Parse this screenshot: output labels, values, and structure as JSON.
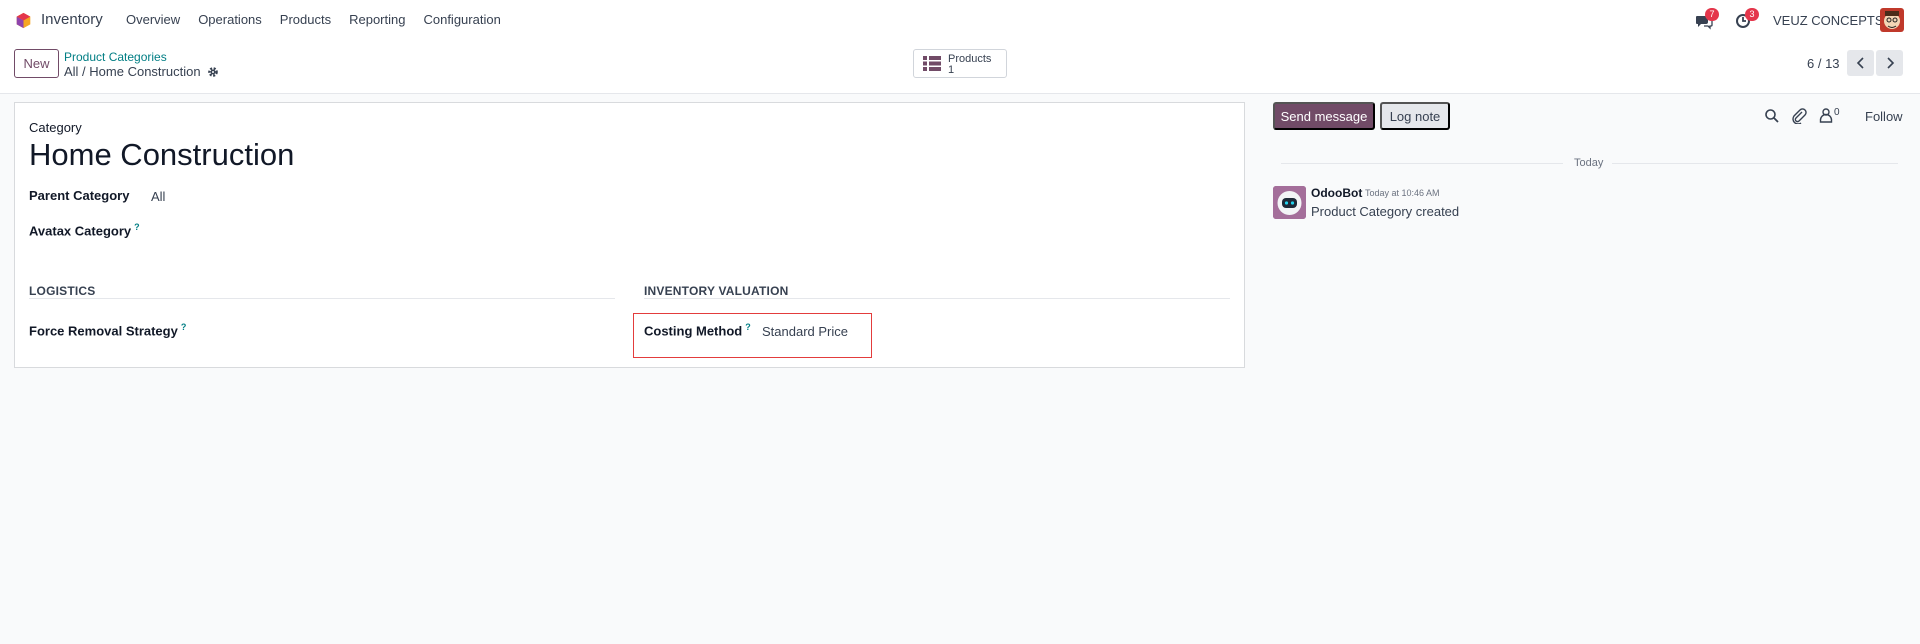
{
  "navbar": {
    "app_name": "Inventory",
    "menu": [
      "Overview",
      "Operations",
      "Products",
      "Reporting",
      "Configuration"
    ],
    "messages_badge": "7",
    "activities_badge": "3",
    "company": "VEUZ CONCEPTS"
  },
  "control": {
    "new_label": "New",
    "breadcrumb_parent": "Product Categories",
    "breadcrumb_current": "All / Home Construction",
    "smart_button": {
      "label": "Products",
      "count": "1"
    },
    "pager": "6 / 13"
  },
  "form": {
    "category_label": "Category",
    "title": "Home Construction",
    "parent_category_label": "Parent Category",
    "parent_category_value": "All",
    "avatax_label": "Avatax Category",
    "help_mark": "?",
    "logistics_title": "LOGISTICS",
    "force_removal_label": "Force Removal Strategy",
    "valuation_title": "INVENTORY VALUATION",
    "costing_method_label": "Costing Method",
    "costing_method_value": "Standard Price"
  },
  "chatter": {
    "send_message": "Send message",
    "log_note": "Log note",
    "followers_count": "0",
    "follow": "Follow",
    "date_separator": "Today",
    "message": {
      "author": "OdooBot",
      "time": "Today at 10:46 AM",
      "body": "Product Category created"
    }
  },
  "colors": {
    "brand": "#714b67",
    "link": "#017e84",
    "badge": "#e4364b",
    "highlight": "#e33c3c"
  },
  "icons": [
    "app-logo-icon",
    "messages-icon",
    "activities-icon",
    "gear-icon",
    "list-icon",
    "chevron-left-icon",
    "chevron-right-icon",
    "search-icon",
    "paperclip-icon",
    "followers-icon"
  ]
}
